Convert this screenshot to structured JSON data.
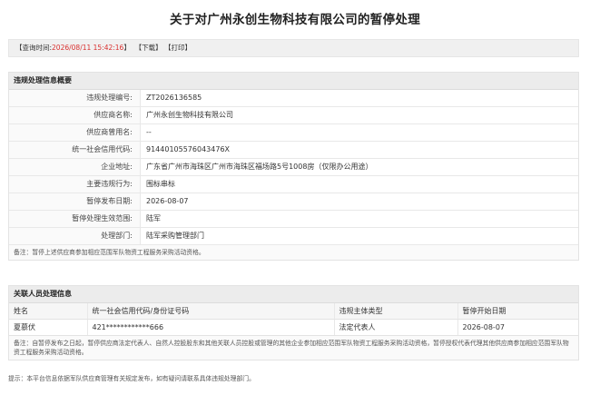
{
  "title": "关于对广州永创生物科技有限公司的暂停处理",
  "query_bar": {
    "prefix": "【查询时间:",
    "time": "2026/08/11 15:42:16",
    "suffix": "】",
    "download": "【下载】",
    "print": "【打印】"
  },
  "violation": {
    "heading": "违规处理信息概要",
    "rows": [
      {
        "key": "违规处理编号:",
        "value": "ZT2026136585"
      },
      {
        "key": "供应商名称:",
        "value": "广州永创生物科技有限公司"
      },
      {
        "key": "供应商曾用名:",
        "value": "--"
      },
      {
        "key": "统一社会信用代码:",
        "value": "91440105576043476X"
      },
      {
        "key": "企业地址:",
        "value": "广东省广州市海珠区广州市海珠区福场路5号1008房（仅限办公用途）"
      },
      {
        "key": "主要违规行为:",
        "value": "围标串标"
      },
      {
        "key": "暂停发布日期:",
        "value": "2026-08-07"
      },
      {
        "key": "暂停处理生效范围:",
        "value": "陆军"
      },
      {
        "key": "处理部门:",
        "value": "陆军采购管理部门"
      }
    ],
    "note": "备注：暂停上述供应商参加相应范围军队物资工程服务采购活动资格。"
  },
  "persons": {
    "heading": "关联人员处理信息",
    "columns": [
      "姓名",
      "统一社会信用代码/身份证号码",
      "违规主体类型",
      "暂停开始日期"
    ],
    "rows": [
      [
        "夏慕伏",
        "421************666",
        "法定代表人",
        "2026-08-07"
      ]
    ],
    "note": "备注：自暂停发布之日起，暂停供应商法定代表人、自然人控股股东和其他关联人员控股或管理的其他企业参加相应范围军队物资工程服务采购活动资格，暂停授权代表代理其他供应商参加相应范围军队物资工程服务采购活动资格。"
  },
  "tip": "提示：本平台信息依据军队供应商管理有关规定发布，如有疑问请联系具体违规处理部门。"
}
